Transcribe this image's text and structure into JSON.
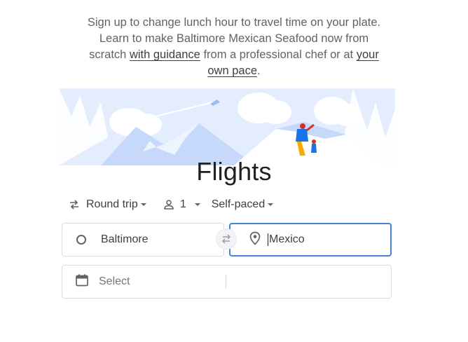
{
  "intro": {
    "text_before": "Sign up to change lunch hour to travel time on your plate. Learn to make Baltimore Mexican Seafood now from scratch ",
    "link1": "with guidance",
    "text_middle": " from a professional chef or at ",
    "link2": "your own pace",
    "text_after": "."
  },
  "title": "Flights",
  "options": {
    "trip_type": "Round trip",
    "passengers": "1",
    "class": "Self-paced"
  },
  "origin": {
    "value": "Baltimore"
  },
  "destination": {
    "value": "Mexico"
  },
  "dates": {
    "placeholder": "Select"
  },
  "colors": {
    "accent": "#4a7fdc",
    "text": "#3c4043",
    "border": "#dadce0",
    "illustration_blue": "#c6d9fb"
  }
}
